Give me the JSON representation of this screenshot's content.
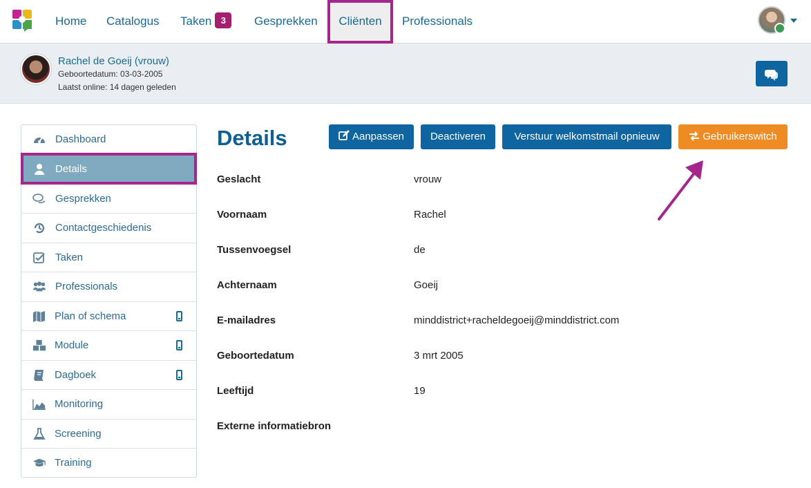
{
  "nav": {
    "items": [
      {
        "label": "Home"
      },
      {
        "label": "Catalogus"
      },
      {
        "label": "Taken",
        "badge": "3"
      },
      {
        "label": "Gesprekken"
      },
      {
        "label": "Cliënten"
      },
      {
        "label": "Professionals"
      }
    ],
    "active": "Cliënten"
  },
  "client": {
    "name": "Rachel de Goeij (vrouw)",
    "birthdate_line": "Geboortedatum: 03-03-2005",
    "last_online_line": "Laatst online: 14 dagen geleden"
  },
  "sidebar": {
    "items": [
      {
        "label": "Dashboard",
        "icon": "dashboard-icon"
      },
      {
        "label": "Details",
        "icon": "user-icon"
      },
      {
        "label": "Gesprekken",
        "icon": "chat-icon"
      },
      {
        "label": "Contactgeschiedenis",
        "icon": "history-icon"
      },
      {
        "label": "Taken",
        "icon": "check-icon"
      },
      {
        "label": "Professionals",
        "icon": "group-icon"
      },
      {
        "label": "Plan of schema",
        "icon": "map-icon",
        "mobile": true
      },
      {
        "label": "Module",
        "icon": "cubes-icon",
        "mobile": true
      },
      {
        "label": "Dagboek",
        "icon": "book-icon",
        "mobile": true
      },
      {
        "label": "Monitoring",
        "icon": "area-chart-icon"
      },
      {
        "label": "Screening",
        "icon": "flask-icon"
      },
      {
        "label": "Training",
        "icon": "graduation-cap-icon"
      }
    ],
    "active": "Details"
  },
  "main": {
    "title": "Details",
    "buttons": {
      "edit": "Aanpassen",
      "deactivate": "Deactiveren",
      "resend": "Verstuur welkomstmail opnieuw",
      "switch": "Gebruikerswitch"
    },
    "fields": [
      {
        "label": "Geslacht",
        "value": "vrouw"
      },
      {
        "label": "Voornaam",
        "value": "Rachel"
      },
      {
        "label": "Tussenvoegsel",
        "value": "de"
      },
      {
        "label": "Achternaam",
        "value": "Goeij"
      },
      {
        "label": "E-mailadres",
        "value": "minddistrict+racheldegoeij@minddistrict.com"
      },
      {
        "label": "Geboortedatum",
        "value": "3 mrt 2005"
      },
      {
        "label": "Leeftijd",
        "value": "19"
      },
      {
        "label": "Externe informatiebron",
        "value": ""
      }
    ]
  },
  "colors": {
    "primary": "#0e65a0",
    "accent_orange": "#ef8b23",
    "highlight": "#a5268b",
    "badge": "#a41f6f",
    "sidebar_active": "#7fa9bf"
  }
}
